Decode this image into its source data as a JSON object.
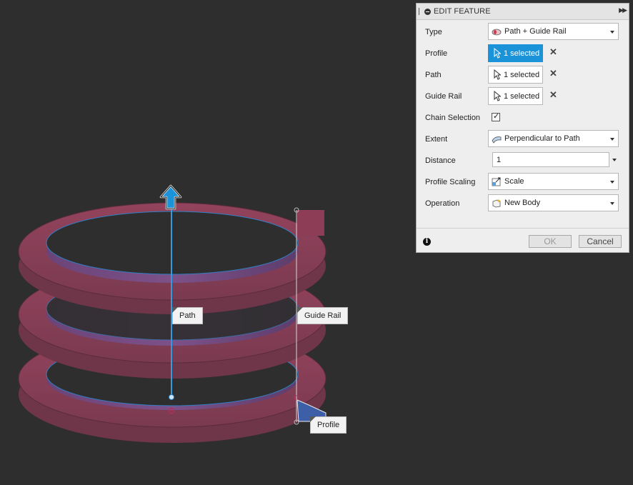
{
  "viewport": {
    "labels": {
      "path": "Path",
      "guide_rail": "Guide Rail",
      "profile": "Profile"
    },
    "colors": {
      "background": "#2e2e2e",
      "body_face": "#8a3f57",
      "body_inner": "#6e4a7a",
      "selection": "#1a93d9"
    }
  },
  "panel": {
    "title": "EDIT FEATURE",
    "rows": {
      "type": {
        "label": "Type",
        "value": "Path + Guide Rail",
        "icon": "sweep-type-icon"
      },
      "profile": {
        "label": "Profile",
        "value": "1 selected",
        "icon": "cursor-icon",
        "active": true
      },
      "path": {
        "label": "Path",
        "value": "1 selected",
        "icon": "cursor-icon"
      },
      "guide_rail": {
        "label": "Guide Rail",
        "value": "1 selected",
        "icon": "cursor-icon"
      },
      "chain_selection": {
        "label": "Chain Selection",
        "checked": true,
        "check_glyph": "✓"
      },
      "extent": {
        "label": "Extent",
        "value": "Perpendicular to Path",
        "icon": "extent-icon"
      },
      "distance": {
        "label": "Distance",
        "value": "1"
      },
      "profile_scaling": {
        "label": "Profile Scaling",
        "value": "Scale",
        "icon": "scale-icon"
      },
      "operation": {
        "label": "Operation",
        "value": "New Body",
        "icon": "new-body-icon"
      }
    },
    "clear_glyph": "✕",
    "footer": {
      "info_glyph": "i",
      "ok_label": "OK",
      "cancel_label": "Cancel"
    }
  }
}
